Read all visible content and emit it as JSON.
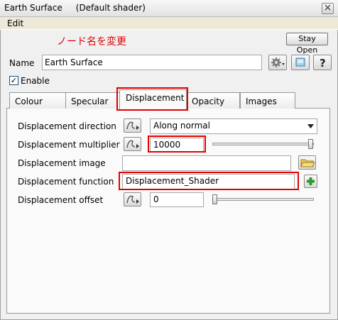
{
  "window": {
    "title": "Earth Surface     (Default shader)",
    "close": "×"
  },
  "menu": {
    "edit": "Edit"
  },
  "annotation": "ノード名を変更",
  "toolbar": {
    "stay_open": "Stay Open"
  },
  "name_field": {
    "label": "Name",
    "value": "Earth Surface"
  },
  "enable": {
    "label": "Enable",
    "checked": true,
    "mark": "✓"
  },
  "tabs": [
    {
      "label": "Colour"
    },
    {
      "label": "Specular"
    },
    {
      "label": "Displacement",
      "active": true
    },
    {
      "label": "Opacity"
    },
    {
      "label": "Images"
    }
  ],
  "rows": {
    "direction": {
      "label": "Displacement direction",
      "value": "Along normal"
    },
    "multiplier": {
      "label": "Displacement multiplier",
      "value": "10000",
      "slider_fraction": 0.98
    },
    "image": {
      "label": "Displacement image",
      "value": ""
    },
    "function": {
      "label": "Displacement function",
      "value": "Displacement_Shader"
    },
    "offset": {
      "label": "Displacement offset",
      "value": "0",
      "slider_fraction": 0.0
    }
  },
  "colors": {
    "highlight": "#e30000",
    "accent": "#1c5180"
  },
  "icons": [
    "gear-icon",
    "color-swatch-icon",
    "help-icon",
    "curve-edit-icon",
    "folder-icon",
    "add-icon",
    "chevron-down-icon"
  ]
}
